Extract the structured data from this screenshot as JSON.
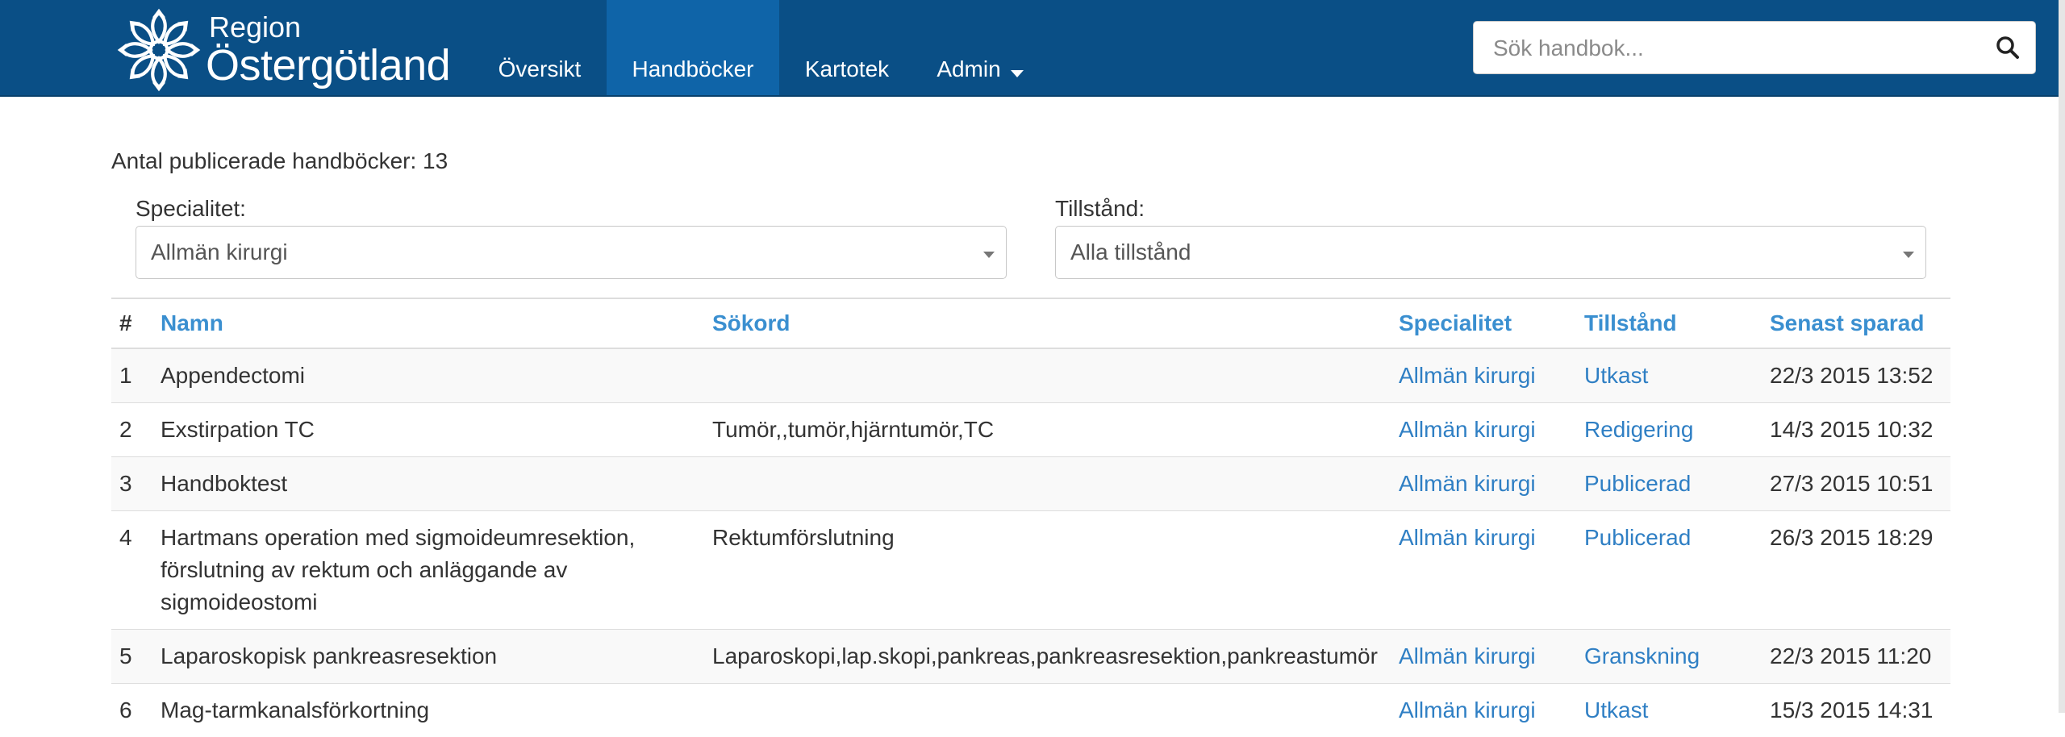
{
  "brand": {
    "line1": "Region",
    "line2": "Östergötland"
  },
  "nav": {
    "items": [
      {
        "label": "Översikt"
      },
      {
        "label": "Handböcker"
      },
      {
        "label": "Kartotek"
      },
      {
        "label": "Admin"
      }
    ]
  },
  "search": {
    "placeholder": "Sök handbok..."
  },
  "summary": {
    "count_text": "Antal publicerade handböcker: 13"
  },
  "filters": {
    "specialty": {
      "label": "Specialitet:",
      "value": "Allmän kirurgi"
    },
    "state": {
      "label": "Tillstånd:",
      "value": "Alla tillstånd"
    }
  },
  "table": {
    "headers": {
      "num": "#",
      "name": "Namn",
      "keywords": "Sökord",
      "specialty": "Specialitet",
      "state": "Tillstånd",
      "saved": "Senast sparad"
    },
    "rows": [
      {
        "num": "1",
        "name": "Appendectomi",
        "keywords": "",
        "specialty": "Allmän kirurgi",
        "state": "Utkast",
        "saved": "22/3 2015 13:52"
      },
      {
        "num": "2",
        "name": "Exstirpation TC",
        "keywords": "Tumör,,tumör,hjärntumör,TC",
        "specialty": "Allmän kirurgi",
        "state": "Redigering",
        "saved": "14/3 2015 10:32"
      },
      {
        "num": "3",
        "name": "Handboktest",
        "keywords": "",
        "specialty": "Allmän kirurgi",
        "state": "Publicerad",
        "saved": "27/3 2015 10:51"
      },
      {
        "num": "4",
        "name": "Hartmans operation med sigmoideumresektion, förslutning av rektum och anläggande av sigmoideostomi",
        "keywords": "Rektumförslutning",
        "specialty": "Allmän kirurgi",
        "state": "Publicerad",
        "saved": "26/3 2015 18:29"
      },
      {
        "num": "5",
        "name": "Laparoskopisk pankreasresektion",
        "keywords": "Laparoskopi,lap.skopi,pankreas,pankreasresektion,pankreastumör",
        "specialty": "Allmän kirurgi",
        "state": "Granskning",
        "saved": "22/3 2015 11:20"
      },
      {
        "num": "6",
        "name": "Mag-tarmkanalsförkortning",
        "keywords": "",
        "specialty": "Allmän kirurgi",
        "state": "Utkast",
        "saved": "15/3 2015 14:31"
      }
    ]
  },
  "colors": {
    "navbar": "#0a4f86",
    "nav_active": "#0f64a8",
    "link": "#2f7fc4",
    "header_link": "#3a8fd0"
  },
  "icons": {
    "logo": "snowflake-logo-icon",
    "search": "search-icon",
    "admin_caret": "caret-down-icon",
    "select_arrow": "select-arrow-icon"
  }
}
